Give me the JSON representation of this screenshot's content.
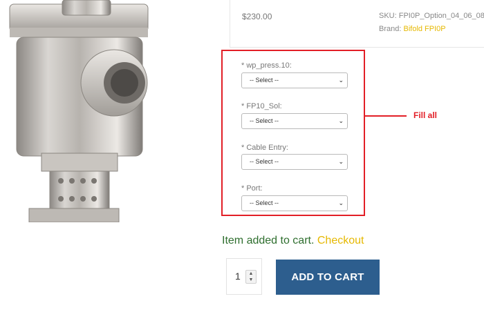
{
  "product": {
    "price": "$230.00",
    "sku_label": "SKU:",
    "sku_value": "FPI0P_Option_04_06_08",
    "brand_label": "Brand:",
    "brand_value": "Bifold FPI0P"
  },
  "options": [
    {
      "label": "wp_press.10:",
      "required_mark": "*",
      "selected": "-- Select --"
    },
    {
      "label": "FP10_Sol:",
      "required_mark": "*",
      "selected": "-- Select --"
    },
    {
      "label": "Cable Entry:",
      "required_mark": "*",
      "selected": "-- Select --"
    },
    {
      "label": "Port:",
      "required_mark": "*",
      "selected": "-- Select --"
    }
  ],
  "annotation": {
    "text": "Fill all",
    "color": "#e21e26"
  },
  "cart_message": {
    "text": "Item added to cart.",
    "link": "Checkout"
  },
  "quantity": {
    "value": "1"
  },
  "add_to_cart": {
    "label": "ADD TO CART",
    "color": "#2d5e8e"
  },
  "colors": {
    "accent_link": "#e6b800",
    "success_text": "#2e6e2e"
  },
  "icons": {
    "select_chevron": "chevron-down-icon",
    "qty_spinner": "spinner-icon"
  }
}
